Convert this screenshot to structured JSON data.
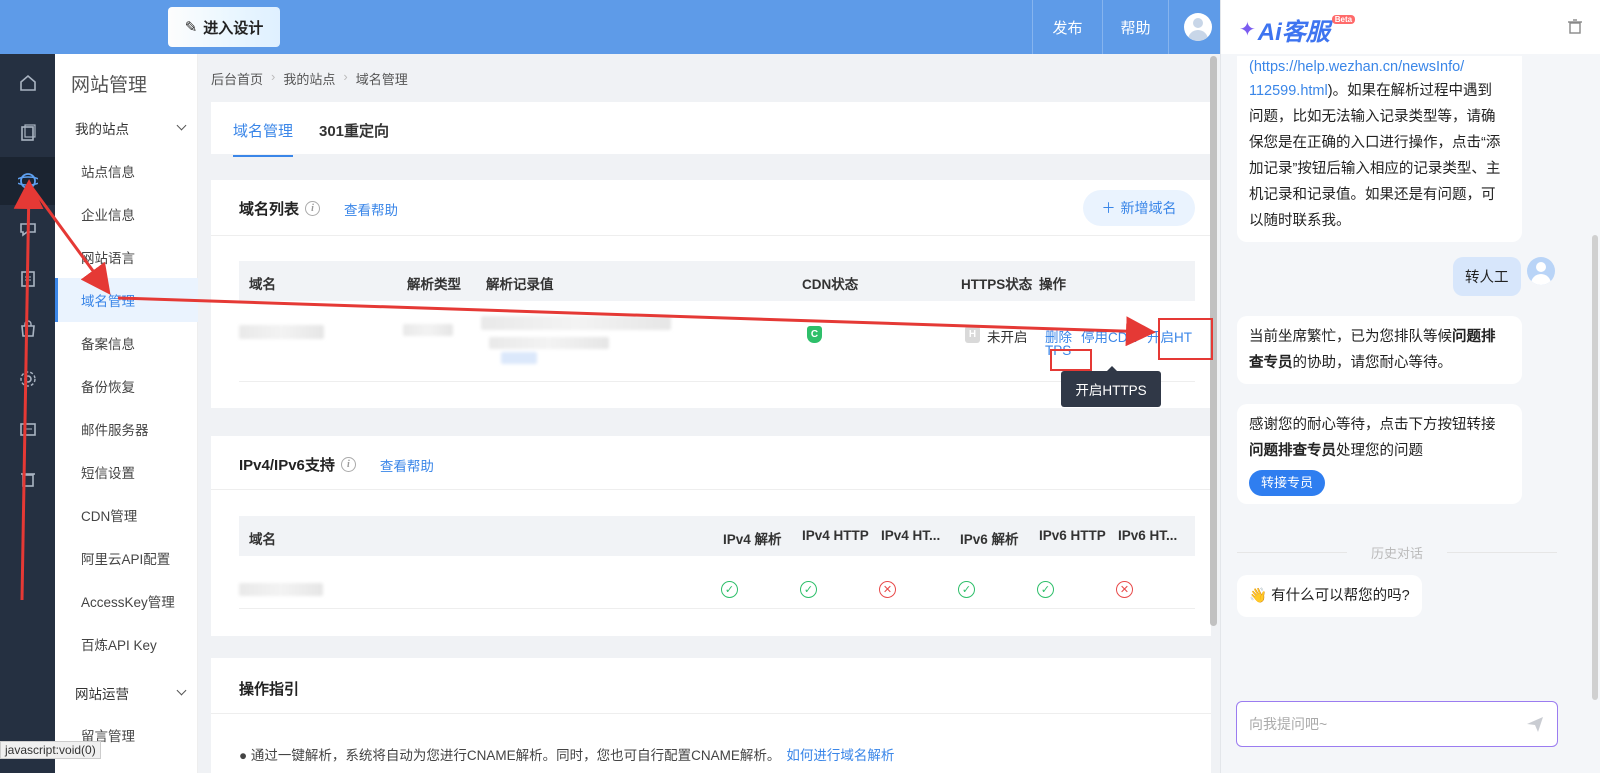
{
  "topbar": {
    "design_label": "进入设计",
    "publish_label": "发布",
    "help_label": "帮助"
  },
  "rail": {
    "icons": [
      "home-icon",
      "pages-icon",
      "globe-icon",
      "chat-icon",
      "doc-icon",
      "shop-icon",
      "settings-icon",
      "mail-icon",
      "trash-icon"
    ]
  },
  "menu": {
    "title": "网站管理",
    "group_my_sites": "我的站点",
    "items": [
      "站点信息",
      "企业信息",
      "网站语言",
      "域名管理",
      "备案信息",
      "备份恢复",
      "邮件服务器",
      "短信设置",
      "CDN管理",
      "阿里云API配置",
      "AccessKey管理",
      "百炼API Key"
    ],
    "group_operations": "网站运营",
    "last_item": "留言管理"
  },
  "breadcrumb": {
    "home": "后台首页",
    "sites": "我的站点",
    "current": "域名管理"
  },
  "tabs": {
    "domain": "域名管理",
    "redirect": "301重定向"
  },
  "domain_list": {
    "title": "域名列表",
    "help": "查看帮助",
    "add_button": "新增域名",
    "columns": [
      "域名",
      "解析类型",
      "解析记录值",
      "CDN状态",
      "HTTPS状态",
      "操作"
    ],
    "row": {
      "cdn_badge": "C",
      "https_badge": "H",
      "https_status": "未开启",
      "delete": "删除",
      "disable_cdn": "停用CDN",
      "enable_https_1": "开启HT",
      "enable_https_2": "TPS"
    },
    "tooltip": "开启HTTPS"
  },
  "ip_support": {
    "title": "IPv4/IPv6支持",
    "help": "查看帮助",
    "columns": [
      "域名",
      "IPv4 解析",
      "IPv4 HTTP",
      "IPv4 HT...",
      "IPv6 解析",
      "IPv6 HTTP",
      "IPv6 HT..."
    ],
    "row_status": [
      "ok",
      "ok",
      "no",
      "ok",
      "ok",
      "no"
    ]
  },
  "guide": {
    "title": "操作指引",
    "text": "● 通过一键解析，系统将自动为您进行CNAME解析。同时，您也可自行配置CNAME解析。",
    "link": "如何进行域名解析"
  },
  "chat": {
    "brand": "Ai客服",
    "beta": "Beta",
    "msg1_lines": [
      "(https://help.wezhan.cn/newsInfo/",
      "112599.html)。如果在解析过程中遇到",
      "问题，比如无法输入记录类型等，请确",
      "保您是在正确的入口进行操作，点击“添",
      "加记录”按钮后输入相应的记录类型、主",
      "机记录和记录值。如果还是有问题，可",
      "以随时联系我。"
    ],
    "user_msg": "转人工",
    "msg2_a": "当前坐席繁忙，已为您排队等候",
    "msg2_b": "问题排",
    "msg2_c": "查专员",
    "msg2_d": "的协助，请您耐心等待。",
    "msg3_a": "感谢您的耐心等待，点击下方按钮转接",
    "msg3_b": "问题排查专员",
    "msg3_c": "处理您的问题",
    "transfer_button": "转接专员",
    "history_divider": "历史对话",
    "greeting": "👋 有什么可以帮您的吗?",
    "input_placeholder": "向我提问吧~"
  },
  "status_bar": "javascript:void(0)"
}
